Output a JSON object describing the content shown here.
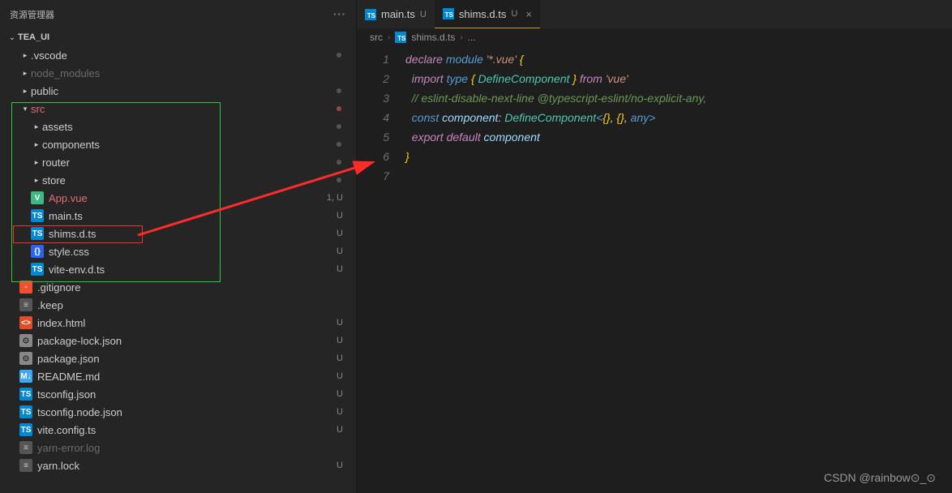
{
  "sidebar": {
    "title": "资源管理器",
    "project": "TEA_UI",
    "items": [
      {
        "type": "folder",
        "label": ".vscode",
        "indent": 1,
        "chev": "▸",
        "dot": true
      },
      {
        "type": "folder",
        "label": "node_modules",
        "indent": 1,
        "chev": "▸",
        "dim": true
      },
      {
        "type": "folder",
        "label": "public",
        "indent": 1,
        "chev": "▸",
        "dot": true
      },
      {
        "type": "folder",
        "label": "src",
        "indent": 1,
        "chev": "▾",
        "class": "src-row",
        "dotU": true
      },
      {
        "type": "folder",
        "label": "assets",
        "indent": 2,
        "chev": "▸",
        "dot": true
      },
      {
        "type": "folder",
        "label": "components",
        "indent": 2,
        "chev": "▸",
        "dot": true
      },
      {
        "type": "folder",
        "label": "router",
        "indent": 2,
        "chev": "▸",
        "dot": true
      },
      {
        "type": "folder",
        "label": "store",
        "indent": 2,
        "chev": "▸",
        "dot": true
      },
      {
        "type": "file",
        "label": "App.vue",
        "indent": 2,
        "icon": "V",
        "iclass": "i-vue",
        "status": "1, U",
        "statusClass": "status-1u",
        "accent": true
      },
      {
        "type": "file",
        "label": "main.ts",
        "indent": 2,
        "icon": "TS",
        "iclass": "i-ts",
        "status": "U"
      },
      {
        "type": "file",
        "label": "shims.d.ts",
        "indent": 2,
        "icon": "TS",
        "iclass": "i-ts",
        "status": "U"
      },
      {
        "type": "file",
        "label": "style.css",
        "indent": 2,
        "icon": "{}",
        "iclass": "i-css",
        "status": "U"
      },
      {
        "type": "file",
        "label": "vite-env.d.ts",
        "indent": 2,
        "icon": "TS",
        "iclass": "i-ts",
        "status": "U"
      },
      {
        "type": "file",
        "label": ".gitignore",
        "indent": 1,
        "icon": "◦",
        "iclass": "i-git"
      },
      {
        "type": "file",
        "label": ".keep",
        "indent": 1,
        "icon": "≡",
        "iclass": "i-txt"
      },
      {
        "type": "file",
        "label": "index.html",
        "indent": 1,
        "icon": "<>",
        "iclass": "i-html",
        "status": "U"
      },
      {
        "type": "file",
        "label": "package-lock.json",
        "indent": 1,
        "icon": "⊙",
        "iclass": "i-json",
        "status": "U"
      },
      {
        "type": "file",
        "label": "package.json",
        "indent": 1,
        "icon": "⊙",
        "iclass": "i-json",
        "status": "U"
      },
      {
        "type": "file",
        "label": "README.md",
        "indent": 1,
        "icon": "M↓",
        "iclass": "i-md",
        "status": "U"
      },
      {
        "type": "file",
        "label": "tsconfig.json",
        "indent": 1,
        "icon": "TS",
        "iclass": "i-ts",
        "status": "U"
      },
      {
        "type": "file",
        "label": "tsconfig.node.json",
        "indent": 1,
        "icon": "TS",
        "iclass": "i-ts",
        "status": "U"
      },
      {
        "type": "file",
        "label": "vite.config.ts",
        "indent": 1,
        "icon": "TS",
        "iclass": "i-ts",
        "status": "U"
      },
      {
        "type": "file",
        "label": "yarn-error.log",
        "indent": 1,
        "icon": "≡",
        "iclass": "i-txt",
        "dim": true
      },
      {
        "type": "file",
        "label": "yarn.lock",
        "indent": 1,
        "icon": "≡",
        "iclass": "i-lock",
        "status": "U"
      }
    ]
  },
  "tabs": [
    {
      "label": "main.ts",
      "mod": "U",
      "active": false
    },
    {
      "label": "shims.d.ts",
      "mod": "U",
      "active": true
    }
  ],
  "breadcrumb": {
    "parts": [
      "src",
      "shims.d.ts",
      "..."
    ]
  },
  "code": {
    "lines": [
      "1",
      "2",
      "3",
      "4",
      "5",
      "6",
      "7"
    ],
    "content": [
      [
        {
          "t": "declare ",
          "c": "tk-kw"
        },
        {
          "t": "module ",
          "c": "tk-kw2"
        },
        {
          "t": "'*.vue'",
          "c": "tk-str"
        },
        {
          "t": " {",
          "c": "tk-brace"
        }
      ],
      [
        {
          "t": "  import ",
          "c": "tk-kw"
        },
        {
          "t": "type ",
          "c": "tk-kw2"
        },
        {
          "t": "{ ",
          "c": "tk-brace"
        },
        {
          "t": "DefineComponent",
          "c": "tk-type"
        },
        {
          "t": " } ",
          "c": "tk-brace"
        },
        {
          "t": "from ",
          "c": "tk-kw"
        },
        {
          "t": "'vue'",
          "c": "tk-str"
        }
      ],
      [
        {
          "t": "  // eslint-disable-next-line @typescript-eslint/no-explicit-any,",
          "c": "tk-comment"
        }
      ],
      [
        {
          "t": "  const ",
          "c": "tk-kw2"
        },
        {
          "t": "component",
          "c": "tk-var"
        },
        {
          "t": ": ",
          "c": "tk-punc"
        },
        {
          "t": "DefineComponent",
          "c": "tk-type"
        },
        {
          "t": "<",
          "c": "tk-ang"
        },
        {
          "t": "{}",
          "c": "tk-brace"
        },
        {
          "t": ", ",
          "c": "tk-punc"
        },
        {
          "t": "{}",
          "c": "tk-brace"
        },
        {
          "t": ", ",
          "c": "tk-punc"
        },
        {
          "t": "any",
          "c": "tk-kw2"
        },
        {
          "t": ">",
          "c": "tk-ang"
        }
      ],
      [
        {
          "t": "  export ",
          "c": "tk-kw"
        },
        {
          "t": "default ",
          "c": "tk-kw"
        },
        {
          "t": "component",
          "c": "tk-var"
        }
      ],
      [
        {
          "t": "}",
          "c": "tk-brace"
        }
      ],
      [
        {
          "t": "",
          "c": ""
        }
      ]
    ]
  },
  "watermark": "CSDN @rainbow⊙_⊙"
}
